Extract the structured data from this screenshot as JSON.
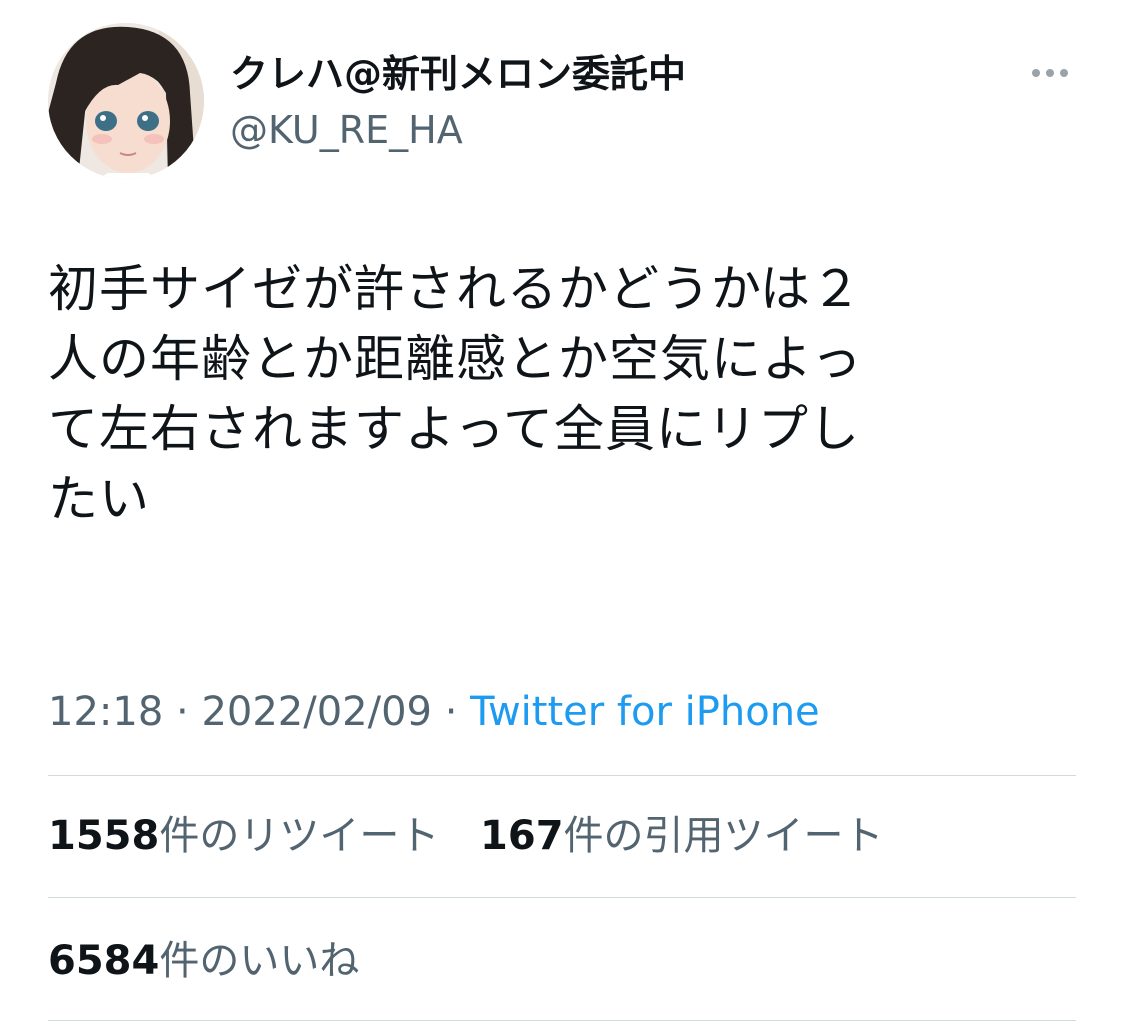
{
  "user": {
    "display_name": "クレハ@新刊メロン委託中",
    "handle": "@KU_RE_HA",
    "avatar": "anime-character-avatar"
  },
  "more_icon": "more-horizontal-icon",
  "tweet": {
    "text": "初手サイゼが許されるかどうかは２\n人の年齢とか距離感とか空気によっ\nて左右されますよって全員にリプし\nたい"
  },
  "meta": {
    "time": "12:18",
    "separator": " · ",
    "date": "2022/02/09",
    "source": "Twitter for iPhone"
  },
  "stats": {
    "retweets": {
      "count": "1558",
      "label": "件のリツイート"
    },
    "quotes": {
      "count": "167",
      "label": "件の引用ツイート"
    },
    "likes": {
      "count": "6584",
      "label": "件のいいね"
    }
  },
  "colors": {
    "text_primary": "#0f1419",
    "text_secondary": "#536471",
    "link": "#1d9bf0",
    "divider": "#cfd9de"
  }
}
